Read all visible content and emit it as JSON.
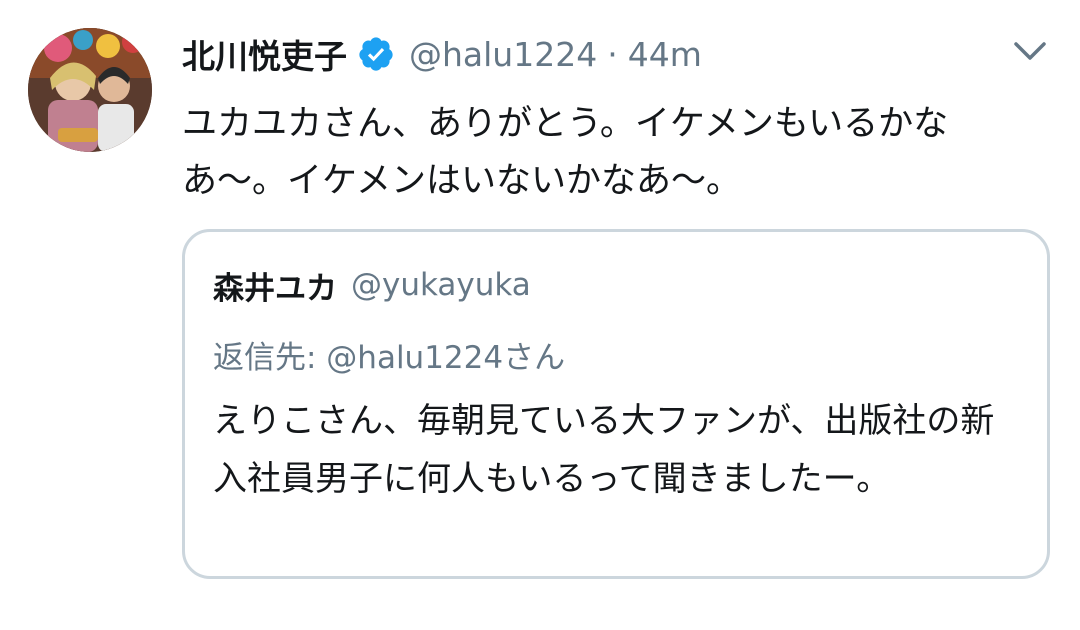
{
  "tweet": {
    "author": {
      "display_name": "北川悦吏子",
      "handle": "@halu1224",
      "verified": true
    },
    "separator": "·",
    "time": "44m",
    "text": "ユカユカさん、ありがとう。イケメンもいるかなあ〜。イケメンはいないかなあ〜。",
    "menu_icon": "chevron-down-icon"
  },
  "quoted_tweet": {
    "display_name": "森井ユカ",
    "handle": "@yukayuka",
    "reply_to": "返信先: @halu1224さん",
    "text": "えりこさん、毎朝見ている大ファンが、出版社の新入社員男子に何人もいるって聞きましたー。"
  },
  "colors": {
    "primary_text": "#14171a",
    "secondary_text": "#657786",
    "verified_blue": "#1da1f2",
    "border": "#ccd6dd"
  }
}
